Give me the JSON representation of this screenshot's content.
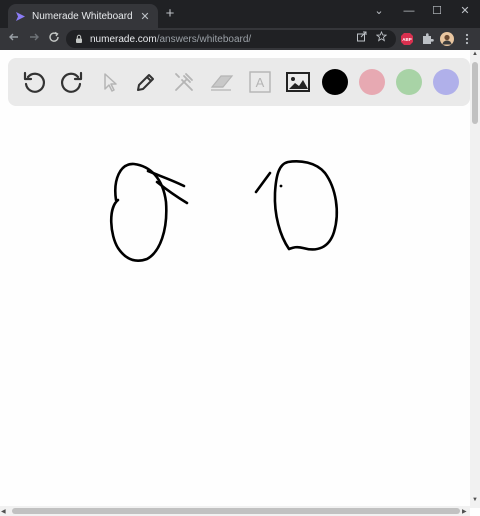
{
  "browser": {
    "tab_title": "Numerade Whiteboard",
    "tab_close": "✕",
    "new_tab": "+",
    "minimize": "⌄",
    "restore": "—",
    "maximize": "☐",
    "close": "✕",
    "url_domain": "numerade.com",
    "url_path": "/answers/whiteboard/",
    "abp_label": "ABP"
  },
  "toolbar": {
    "swatches": [
      {
        "name": "black",
        "color": "#000000"
      },
      {
        "name": "pink",
        "color": "#e7a9b2"
      },
      {
        "name": "green",
        "color": "#a8d3a6"
      },
      {
        "name": "lavender",
        "color": "#b0b0ea"
      }
    ],
    "text_tool_label": "A"
  },
  "colors": {
    "accent": "#8b7cf6",
    "chrome_dark": "#202124",
    "chrome_mid": "#35363a"
  }
}
